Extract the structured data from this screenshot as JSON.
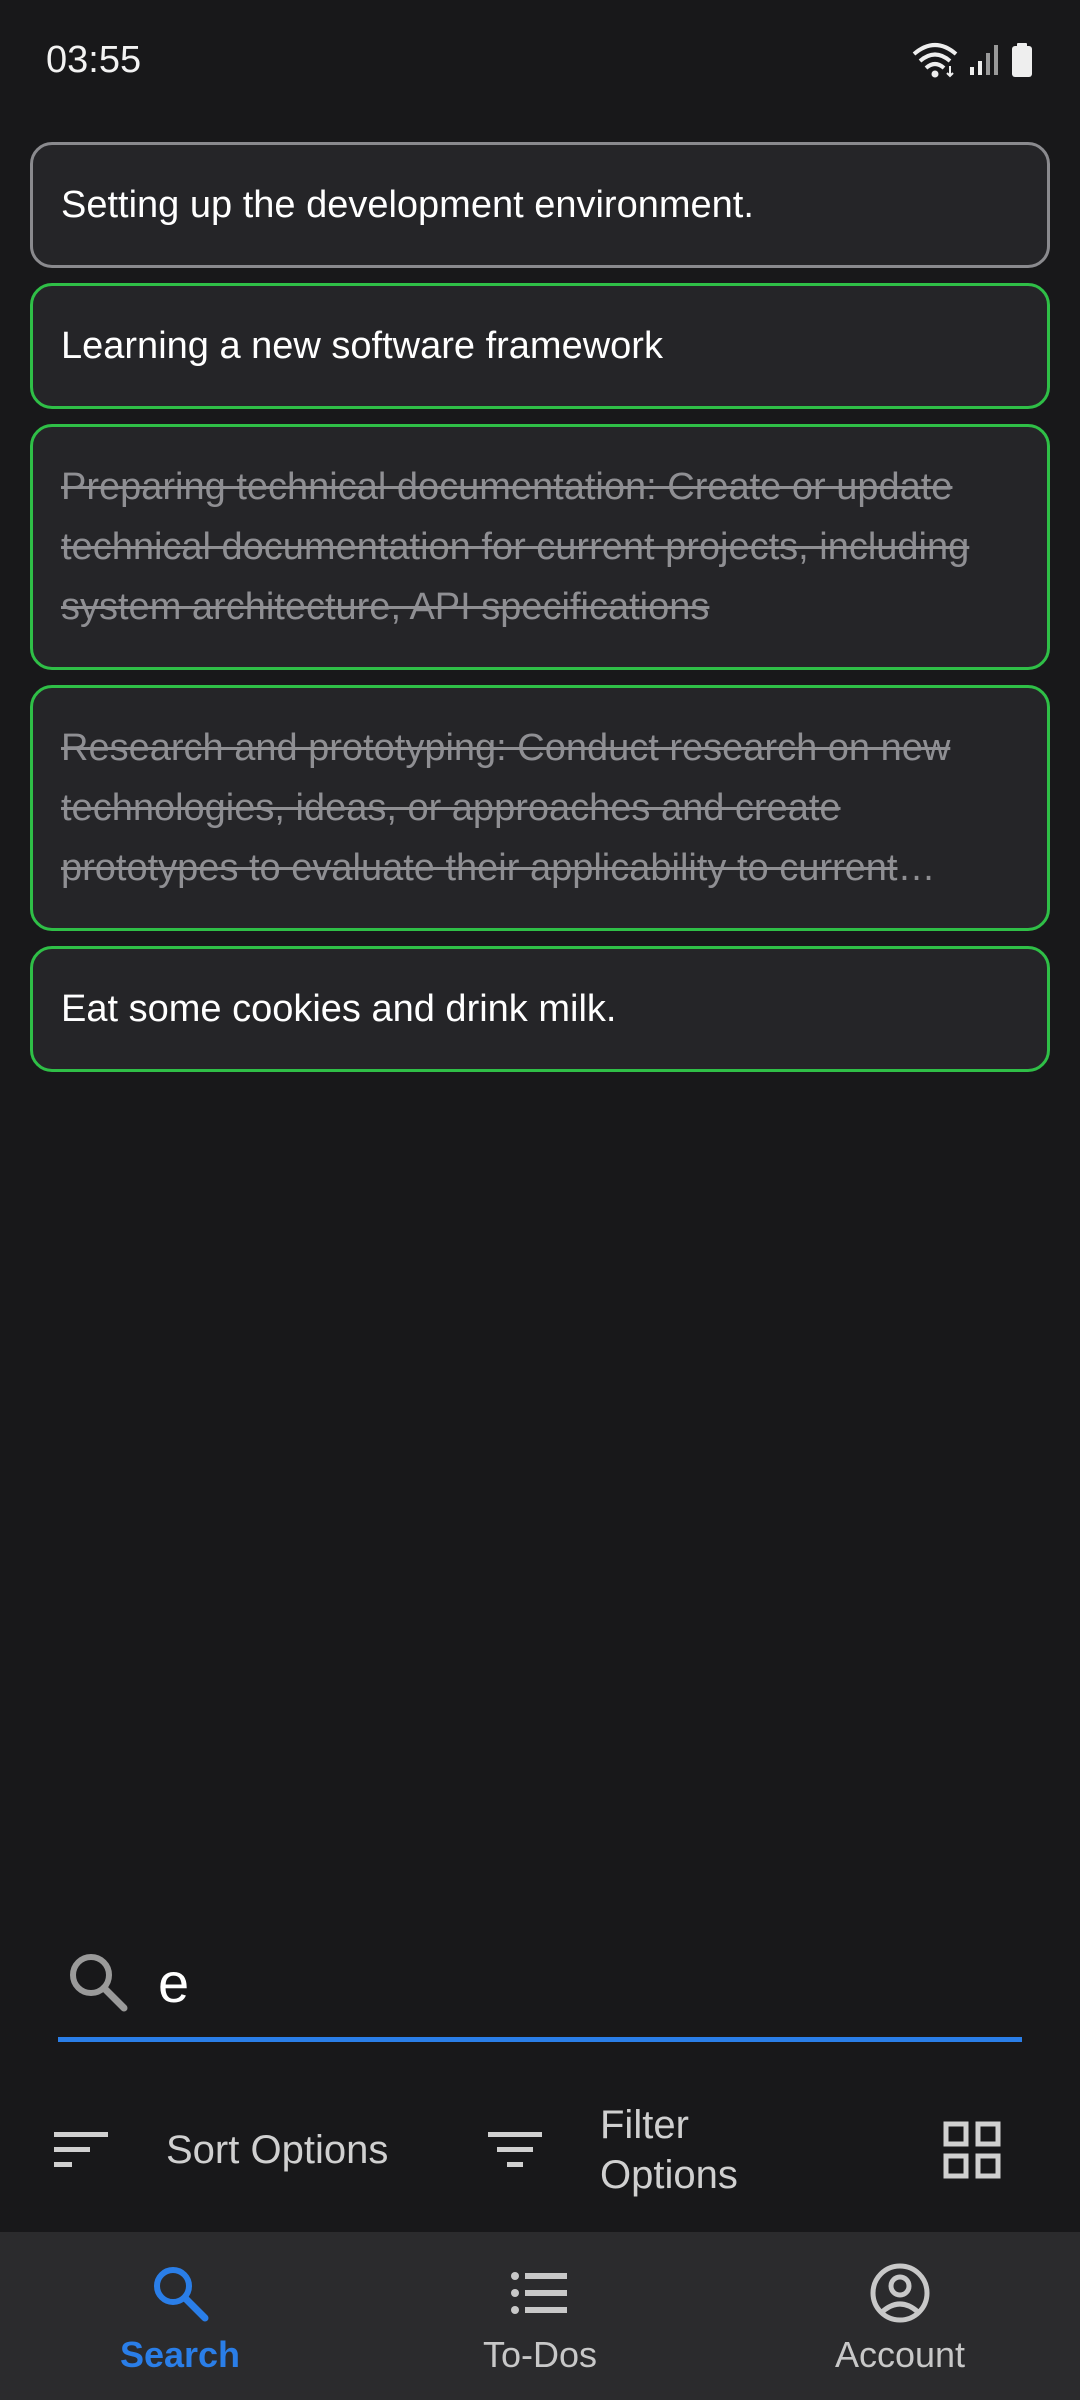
{
  "status_bar": {
    "time": "03:55"
  },
  "todos": [
    {
      "text": "Setting up the development environment.",
      "style": "neutral",
      "completed": false
    },
    {
      "text": "Learning a new software framework",
      "style": "green",
      "completed": false
    },
    {
      "text": "Preparing technical documentation: Create or update technical documentation for current projects, including system architecture, API specifications",
      "style": "green",
      "completed": true
    },
    {
      "text": "Research and prototyping: Conduct research on new technologies, ideas, or approaches and create prototypes to evaluate their applicability to current projects",
      "style": "green",
      "completed": true
    },
    {
      "text": "Eat some cookies and drink milk.",
      "style": "green",
      "completed": false
    }
  ],
  "search": {
    "value": "e",
    "accent": "#2a7ee8"
  },
  "toolbar": {
    "sort_label": "Sort Options",
    "filter_label": "Filter Options"
  },
  "nav": {
    "items": [
      {
        "label": "Search",
        "icon": "search-icon",
        "active": true
      },
      {
        "label": "To-Dos",
        "icon": "list-icon",
        "active": false
      },
      {
        "label": "Account",
        "icon": "account-circle-icon",
        "active": false
      }
    ]
  },
  "colors": {
    "background": "#18181a",
    "card": "#252528",
    "card_border_green": "#2fbf47",
    "card_border_neutral": "#8a8a8e",
    "nav_background": "#2b2b2d",
    "accent": "#2a7ee8"
  }
}
